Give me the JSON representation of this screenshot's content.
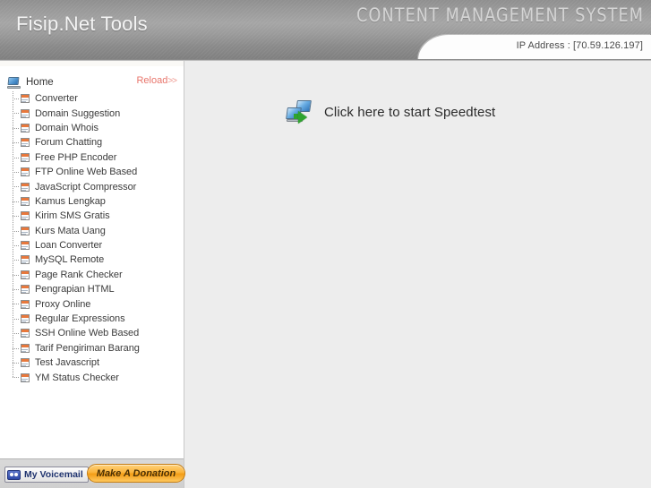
{
  "header": {
    "title": "Fisip.Net Tools",
    "cms_label": "CONTENT MANAGEMENT SYSTEM",
    "ip_address": "IP Address : [70.59.126.197]"
  },
  "sidebar": {
    "reload_label": "Reload",
    "reload_chevrons": ">>",
    "root": {
      "label": "Home",
      "icon": "monitor-icon"
    },
    "items": [
      {
        "label": "Converter",
        "icon": "page-icon"
      },
      {
        "label": "Domain Suggestion",
        "icon": "page-icon"
      },
      {
        "label": "Domain Whois",
        "icon": "page-icon"
      },
      {
        "label": "Forum Chatting",
        "icon": "page-icon"
      },
      {
        "label": "Free PHP Encoder",
        "icon": "page-icon"
      },
      {
        "label": "FTP Online Web Based",
        "icon": "page-icon"
      },
      {
        "label": "JavaScript Compressor",
        "icon": "page-icon"
      },
      {
        "label": "Kamus Lengkap",
        "icon": "page-icon"
      },
      {
        "label": "Kirim SMS Gratis",
        "icon": "page-icon"
      },
      {
        "label": "Kurs Mata Uang",
        "icon": "page-icon"
      },
      {
        "label": "Loan Converter",
        "icon": "page-icon"
      },
      {
        "label": "MySQL Remote",
        "icon": "page-icon"
      },
      {
        "label": "Page Rank Checker",
        "icon": "page-icon"
      },
      {
        "label": "Pengrapian HTML",
        "icon": "page-icon"
      },
      {
        "label": "Proxy Online",
        "icon": "page-icon"
      },
      {
        "label": "Regular Expressions",
        "icon": "page-icon"
      },
      {
        "label": "SSH Online Web Based",
        "icon": "page-icon"
      },
      {
        "label": "Tarif Pengiriman Barang",
        "icon": "page-icon"
      },
      {
        "label": "Test Javascript",
        "icon": "page-icon"
      },
      {
        "label": "YM Status Checker",
        "icon": "page-icon"
      }
    ],
    "footer": {
      "voicemail_label": "My Voicemail",
      "voicemail_icon": "voicemail-icon",
      "donation_label": "Make A Donation"
    }
  },
  "main": {
    "speedtest_label": "Click here to start Speedtest",
    "speedtest_icon": "network-computers-icon"
  },
  "colors": {
    "header_grey": "#9a9a9a",
    "page_background": "#ededed",
    "sidebar_background": "#ffffff",
    "reload_red": "#e8756b",
    "donation_orange": "#f9b33c",
    "voicemail_blue": "#2f4aa8",
    "arrow_green": "#2fa32f",
    "icon_orange": "#e8783c"
  }
}
